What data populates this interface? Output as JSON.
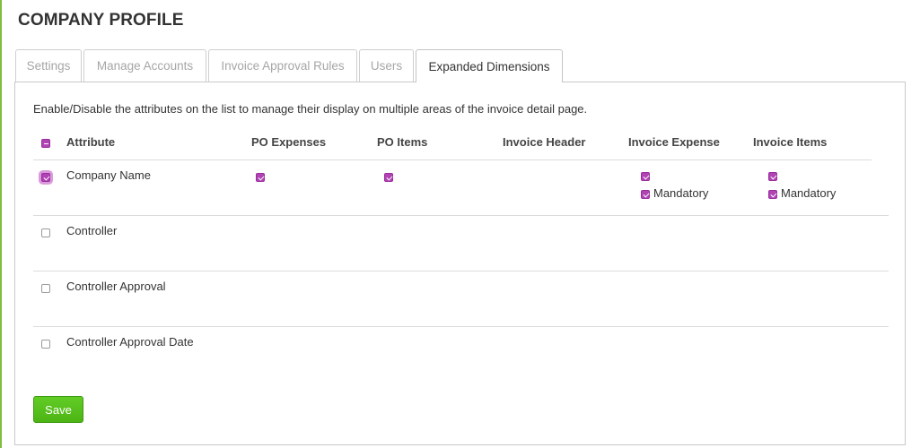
{
  "page": {
    "title": "COMPANY PROFILE"
  },
  "tabs": [
    {
      "label": "Settings",
      "active": false
    },
    {
      "label": "Manage Accounts",
      "active": false
    },
    {
      "label": "Invoice Approval Rules",
      "active": false
    },
    {
      "label": "Users",
      "active": false
    },
    {
      "label": "Expanded Dimensions",
      "active": true
    }
  ],
  "panel": {
    "description": "Enable/Disable the attributes on the list to manage their display on multiple areas of the invoice detail page.",
    "select_all_state": "partial",
    "columns": [
      "Attribute",
      "PO Expenses",
      "PO Items",
      "Invoice Header",
      "Invoice Expense",
      "Invoice Items"
    ],
    "mandatory_label": "Mandatory",
    "rows": [
      {
        "label": "Company Name",
        "enabled": true,
        "po_expenses": true,
        "po_items": true,
        "invoice_expense": true,
        "invoice_expense_mandatory": true,
        "invoice_items": true,
        "invoice_items_mandatory": true
      },
      {
        "label": "Controller",
        "enabled": false
      },
      {
        "label": "Controller Approval",
        "enabled": false
      },
      {
        "label": "Controller Approval Date",
        "enabled": false
      }
    ],
    "save_label": "Save"
  },
  "colors": {
    "accent": "#b044b3",
    "save_button": "#52b81a",
    "left_border": "#7fbf3f"
  }
}
